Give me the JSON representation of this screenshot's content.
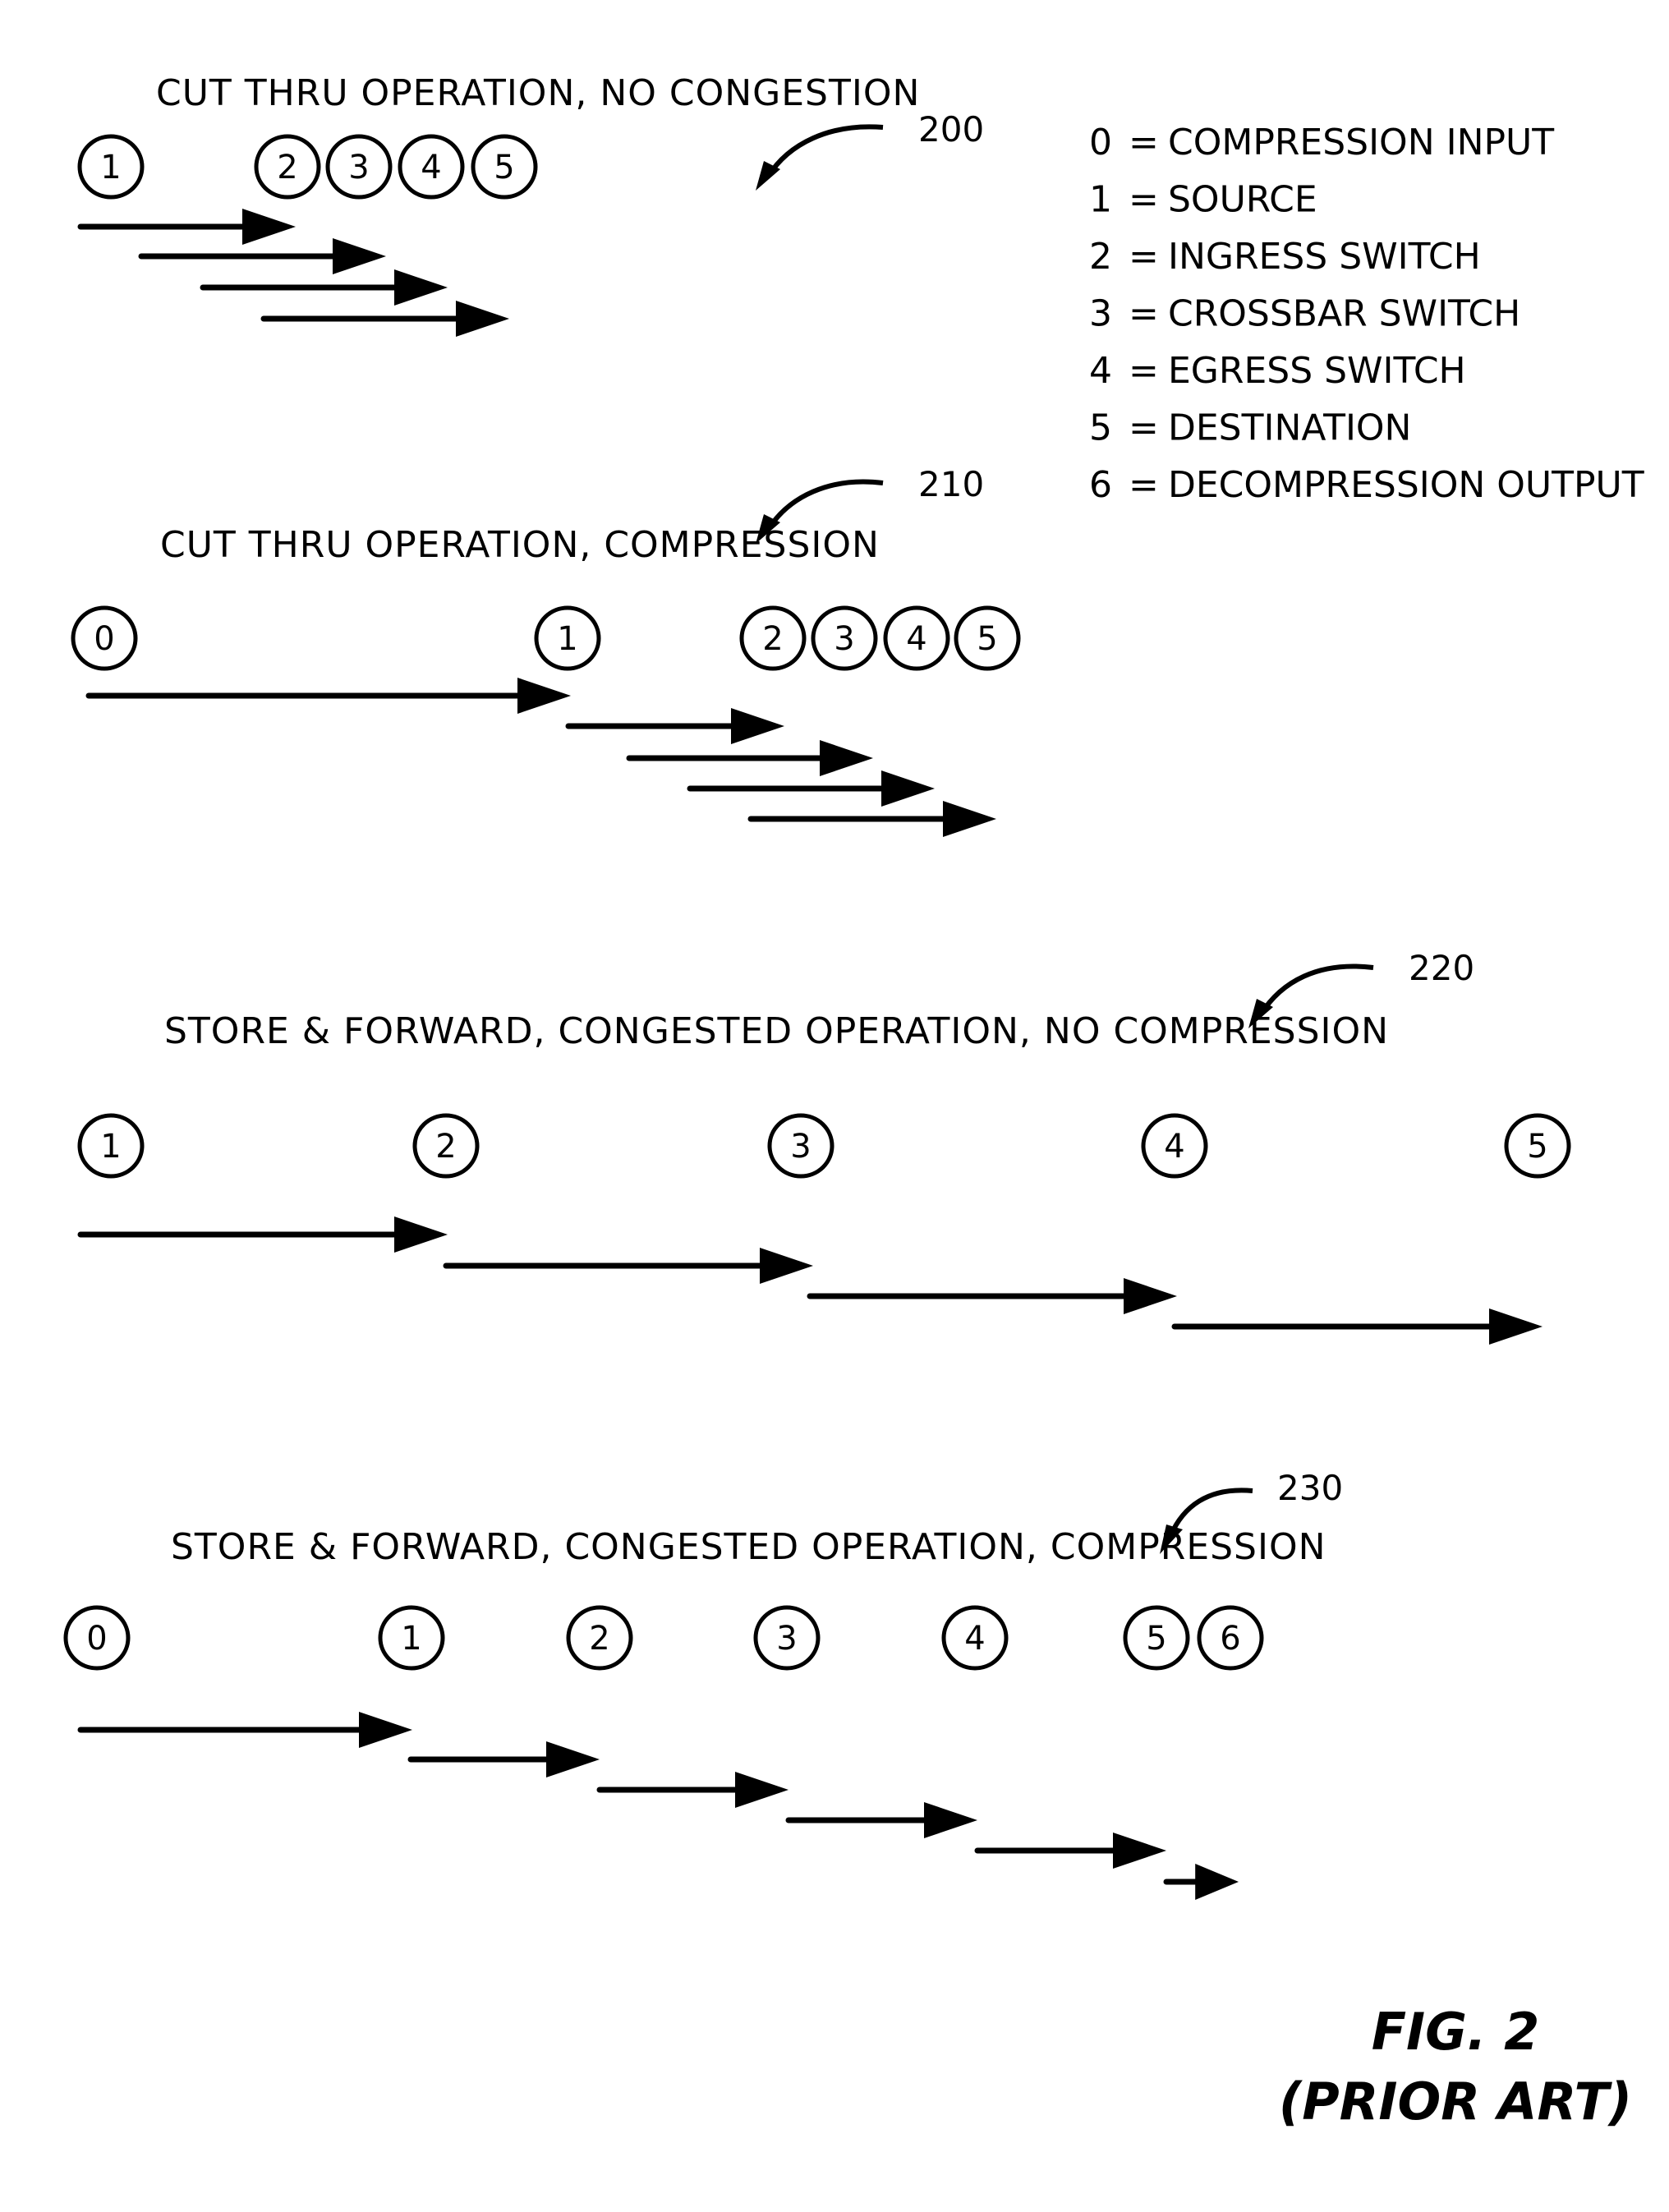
{
  "legend": [
    {
      "key": "0",
      "label": "COMPRESSION INPUT"
    },
    {
      "key": "1",
      "label": "SOURCE"
    },
    {
      "key": "2",
      "label": "INGRESS SWITCH"
    },
    {
      "key": "3",
      "label": "CROSSBAR SWITCH"
    },
    {
      "key": "4",
      "label": "EGRESS SWITCH"
    },
    {
      "key": "5",
      "label": "DESTINATION"
    },
    {
      "key": "6",
      "label": "DECOMPRESSION OUTPUT"
    }
  ],
  "legend_separator": "=",
  "sections": [
    {
      "ref": "200",
      "title": "CUT THRU OPERATION, NO CONGESTION",
      "nodes": [
        "1",
        "2",
        "3",
        "4",
        "5"
      ],
      "arrow_count": 4
    },
    {
      "ref": "210",
      "title": "CUT THRU OPERATION, COMPRESSION",
      "nodes": [
        "0",
        "1",
        "2",
        "3",
        "4",
        "5"
      ],
      "arrow_count": 5
    },
    {
      "ref": "220",
      "title": "STORE & FORWARD, CONGESTED OPERATION, NO COMPRESSION",
      "nodes": [
        "1",
        "2",
        "3",
        "4",
        "5"
      ],
      "arrow_count": 4
    },
    {
      "ref": "230",
      "title": "STORE & FORWARD, CONGESTED OPERATION, COMPRESSION",
      "nodes": [
        "0",
        "1",
        "2",
        "3",
        "4",
        "5",
        "6"
      ],
      "arrow_count": 6
    }
  ],
  "figure": {
    "label": "FIG. 2",
    "caption": "(PRIOR ART)"
  }
}
